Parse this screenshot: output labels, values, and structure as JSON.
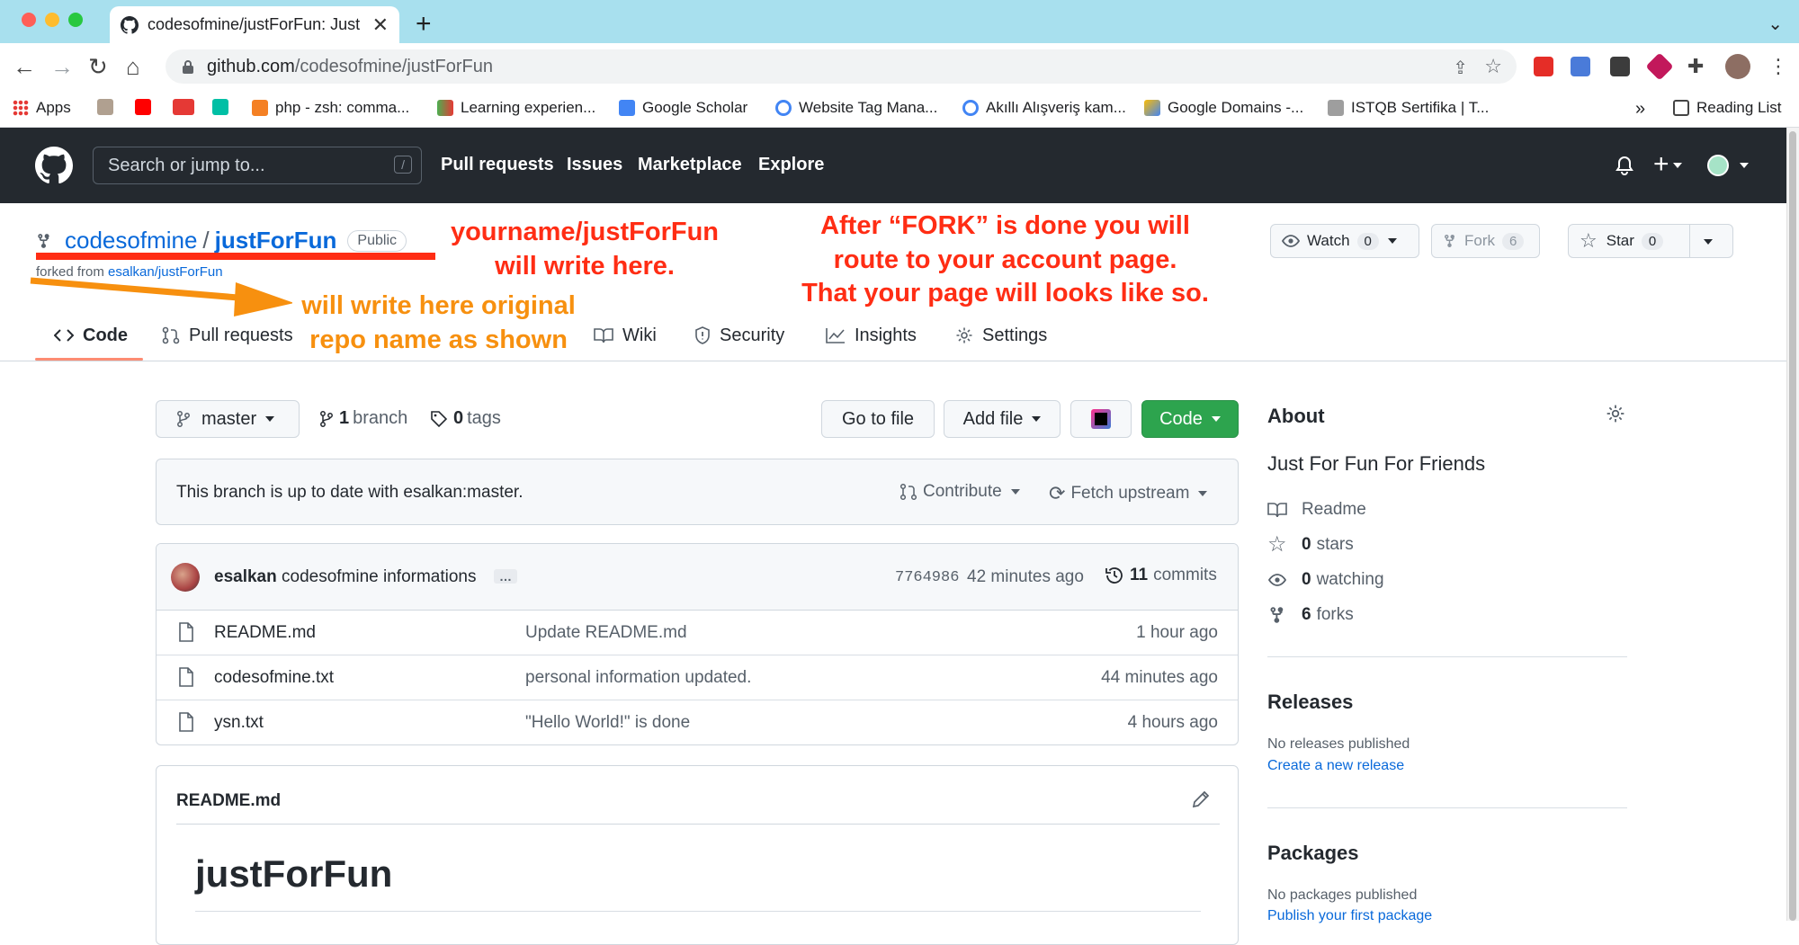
{
  "browser": {
    "tab_title": "codesofmine/justForFun: Just F",
    "url_host": "github.com",
    "url_path": "/codesofmine/justForFun",
    "bookmarks": [
      "Apps",
      "php - zsh: comma...",
      "Learning experien...",
      "Google Scholar",
      "Website Tag Mana...",
      "Akıllı Alışveriş kam...",
      "Google Domains -...",
      "ISTQB Sertifika | T..."
    ],
    "overflow": "»",
    "reading_list": "Reading List"
  },
  "gh_header": {
    "search_placeholder": "Search or jump to...",
    "search_shortcut": "/",
    "nav": [
      "Pull requests",
      "Issues",
      "Marketplace",
      "Explore"
    ]
  },
  "repo": {
    "owner": "codesofmine",
    "separator": "/",
    "name": "justForFun",
    "visibility": "Public",
    "forked_prefix": "forked from",
    "forked_source": "esalkan/justForFun",
    "watch_label": "Watch",
    "watch_count": "0",
    "fork_label": "Fork",
    "fork_count": "6",
    "star_label": "Star",
    "star_count": "0",
    "tabs": [
      "Code",
      "Pull requests",
      "Wiki",
      "Security",
      "Insights",
      "Settings"
    ]
  },
  "annotations": {
    "yourname_1": "yourname/justForFun",
    "yourname_2": "will write here.",
    "original_1": "will write here  original",
    "original_2": "repo name as shown",
    "after_1": "After “FORK” is done you will",
    "after_2": "route to your account page.",
    "after_3": "That your page will looks like so."
  },
  "toolbar": {
    "branch": "master",
    "branch_count": "1",
    "branch_label": "branch",
    "tag_count": "0",
    "tag_label": "tags",
    "go_to_file": "Go to file",
    "add_file": "Add file",
    "code": "Code"
  },
  "sync": {
    "message": "This branch is up to date with esalkan:master.",
    "contribute": "Contribute",
    "fetch": "Fetch upstream"
  },
  "commit": {
    "author": "esalkan",
    "message": "codesofmine informations",
    "ellipsis": "…",
    "sha": "7764986",
    "time": "42 minutes ago",
    "commits_count": "11",
    "commits_label": "commits"
  },
  "files": [
    {
      "name": "README.md",
      "message": "Update README.md",
      "age": "1 hour ago"
    },
    {
      "name": "codesofmine.txt",
      "message": "personal information updated.",
      "age": "44 minutes ago"
    },
    {
      "name": "ysn.txt",
      "message": "\"Hello World!\" is done",
      "age": "4 hours ago"
    }
  ],
  "readme": {
    "filename": "README.md",
    "heading": "justForFun"
  },
  "sidebar": {
    "about_title": "About",
    "description": "Just For Fun For Friends",
    "readme": "Readme",
    "stars_count": "0",
    "stars_label": "stars",
    "watching_count": "0",
    "watching_label": "watching",
    "forks_count": "6",
    "forks_label": "forks",
    "releases_title": "Releases",
    "releases_none": "No releases published",
    "releases_link": "Create a new release",
    "packages_title": "Packages",
    "packages_none": "No packages published",
    "packages_link": "Publish your first package"
  },
  "colors": {
    "annotation_red": "#ff2d14",
    "annotation_orange": "#f7900f",
    "link_blue": "#0969da",
    "code_button_green": "#2da44e",
    "gh_header_bg": "#24292f"
  }
}
